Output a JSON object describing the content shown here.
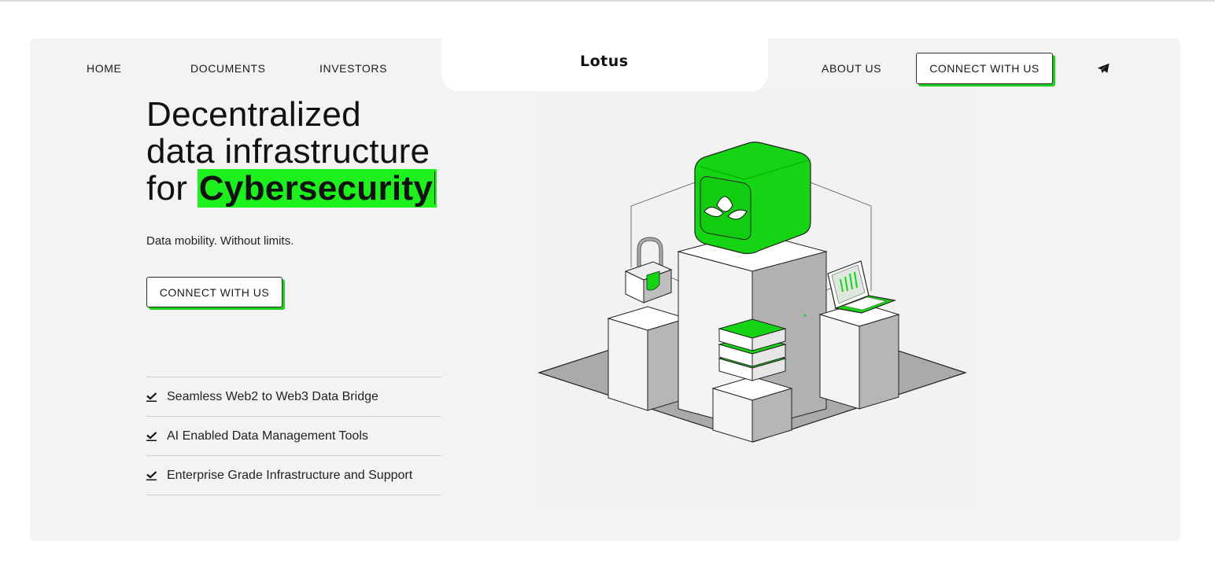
{
  "nav": {
    "home": "HOME",
    "documents": "DOCUMENTS",
    "investors": "INVESTORS",
    "logo": "Lotus",
    "about": "ABOUT US",
    "connect": "CONNECT WITH US",
    "telegram_icon": "telegram-icon"
  },
  "hero": {
    "headline_line1": "Decentralized",
    "headline_line2": "data infrastructure",
    "headline_for": "for ",
    "headline_highlight": "Cybersecurity",
    "tagline": "Data mobility. Without limits.",
    "cta": "CONNECT WITH US"
  },
  "features": [
    {
      "icon": "check-icon",
      "label": "Seamless Web2 to Web3 Data Bridge"
    },
    {
      "icon": "check-icon",
      "label": "AI Enabled Data Management Tools"
    },
    {
      "icon": "check-icon",
      "label": "Enterprise Grade Infrastructure and Support"
    }
  ],
  "colors": {
    "accent": "#1ef01e",
    "accent_dark": "#12b812",
    "panel": "#f3f3f3"
  }
}
